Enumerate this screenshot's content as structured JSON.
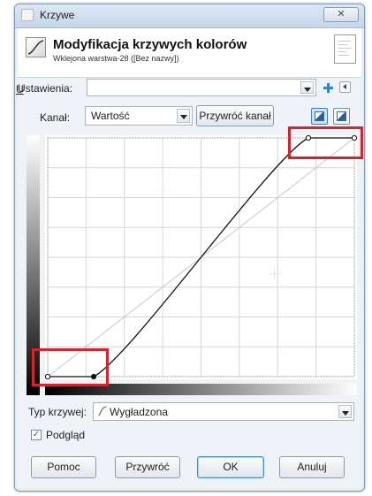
{
  "window": {
    "title": "Krzywe",
    "close_glyph": "✕"
  },
  "header": {
    "title": "Modyfikacja krzywych kolorów",
    "subtitle": "Wklejona warstwa-28 ([Bez nazwy])",
    "icon": "curves-tool-icon",
    "thumbnail_icon": "layer-thumbnail"
  },
  "presets": {
    "label": "Ustawienia:",
    "value": "",
    "add_icon": "plus-icon",
    "menu_icon": "menu-arrow-icon"
  },
  "channel": {
    "label": "Kanał:",
    "value": "Wartość",
    "reset_label": "Przywróć kanał",
    "histogram_modes": [
      "linear-histogram-icon",
      "logarithmic-histogram-icon"
    ]
  },
  "curve": {
    "points": [
      [
        0,
        0
      ],
      [
        15,
        0
      ],
      [
        85,
        100
      ],
      [
        100,
        100
      ]
    ],
    "grid_divisions": 8
  },
  "curve_type": {
    "label": "Typ krzywej:",
    "value": "Wygładzona",
    "icon": "curve-type-icon"
  },
  "preview": {
    "label": "Podgląd",
    "checked": true,
    "check_glyph": "✓"
  },
  "buttons": {
    "help": "Pomoc",
    "reset": "Przywróć",
    "ok": "OK",
    "cancel": "Anuluj"
  },
  "colors": {
    "highlight": "#d8232a",
    "accent": "#3a7fd1"
  }
}
